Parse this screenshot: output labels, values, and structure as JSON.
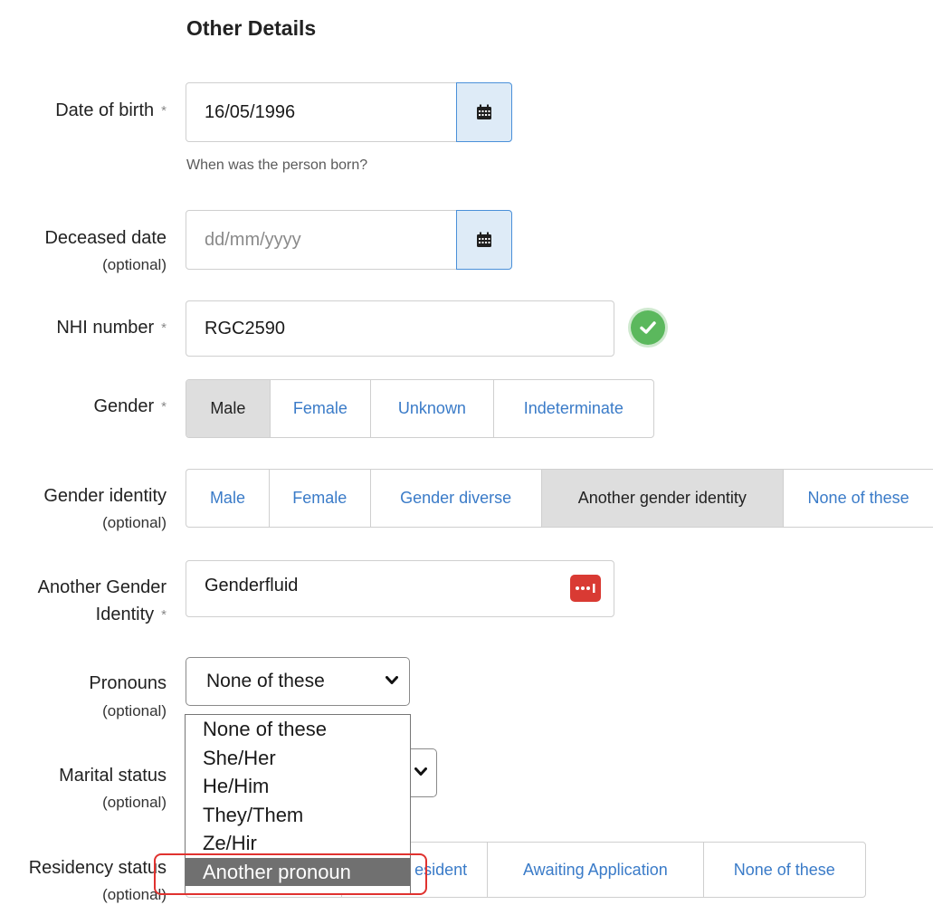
{
  "section_title": "Other Details",
  "required_marker": "*",
  "optional_text": "(optional)",
  "dob": {
    "label": "Date of birth",
    "value": "16/05/1996",
    "hint": "When was the person born?",
    "icon": "calendar-icon"
  },
  "deceased": {
    "label": "Deceased date",
    "placeholder": "dd/mm/yyyy",
    "icon": "calendar-icon"
  },
  "nhi": {
    "label": "NHI number",
    "value": "RGC2590",
    "status_icon": "check-circle-icon",
    "status_color": "#5bb85d"
  },
  "gender": {
    "label": "Gender",
    "options": [
      "Male",
      "Female",
      "Unknown",
      "Indeterminate"
    ],
    "selected": "Male"
  },
  "gender_identity": {
    "label": "Gender identity",
    "options": [
      "Male",
      "Female",
      "Gender diverse",
      "Another gender identity",
      "None of these"
    ],
    "selected": "Another gender identity"
  },
  "another_gender": {
    "label_line1": "Another Gender",
    "label_line2": "Identity",
    "value": "Genderfluid",
    "icon": "password-manager-icon",
    "icon_color": "#d93a33"
  },
  "pronouns": {
    "label": "Pronouns",
    "value": "None of these",
    "dropdown_options": [
      "None of these",
      "She/Her",
      "He/Him",
      "They/Them",
      "Ze/Hir",
      "Another pronoun"
    ],
    "highlighted": "Another pronoun"
  },
  "marital": {
    "label": "Marital status"
  },
  "residency": {
    "label": "Residency status",
    "visible_options": [
      "esident",
      "Awaiting Application",
      "None of these"
    ]
  },
  "colors": {
    "link": "#3a7bc8",
    "selected_bg": "#dedede",
    "highlight_border": "#e0322f"
  }
}
